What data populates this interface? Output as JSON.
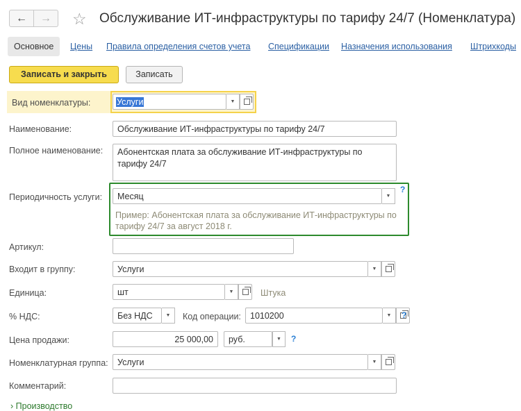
{
  "window": {
    "title": "Обслуживание ИТ-инфраструктуры по тарифу 24/7 (Номенклатура)",
    "back_icon": "←",
    "forward_icon": "→",
    "star_icon": "☆"
  },
  "tabs": {
    "active": "Основное",
    "links": [
      "Цены",
      "Правила определения счетов учета",
      "Спецификации",
      "Назначения использования",
      "Штрихкоды"
    ]
  },
  "toolbar": {
    "save_close_label": "Записать и закрыть",
    "save_label": "Записать"
  },
  "form": {
    "vid": {
      "label": "Вид номенклатуры:",
      "value": "Услуги"
    },
    "name": {
      "label": "Наименование:",
      "value": "Обслуживание ИТ-инфраструктуры по тарифу 24/7"
    },
    "full_name": {
      "label": "Полное наименование:",
      "value": "Абонентская плата за обслуживание ИТ-инфраструктуры по тарифу 24/7"
    },
    "periodicity": {
      "label": "Периодичность услуги:",
      "value": "Месяц",
      "hint": "Пример: Абонентская плата за обслуживание ИТ-инфраструктуры по тарифу 24/7 за август 2018 г."
    },
    "article": {
      "label": "Артикул:",
      "value": ""
    },
    "group": {
      "label": "Входит в группу:",
      "value": "Услуги"
    },
    "unit": {
      "label": "Единица:",
      "value": "шт",
      "full": "Штука"
    },
    "vat": {
      "label": "% НДС:",
      "value": "Без НДС",
      "op_label": "Код операции:",
      "op_value": "1010200"
    },
    "price": {
      "label": "Цена продажи:",
      "value": "25 000,00",
      "currency": "руб."
    },
    "nom_group": {
      "label": "Номенклатурная группа:",
      "value": "Услуги"
    },
    "comment": {
      "label": "Комментарий:",
      "value": ""
    }
  },
  "section": {
    "label": "Производство",
    "chevron": "›"
  },
  "help_glyph": "?",
  "colors": {
    "primary": "#f7dc4e",
    "link": "#2a5fa3",
    "highlight": "#fdf4cc",
    "focus": "#2d8a2d"
  }
}
